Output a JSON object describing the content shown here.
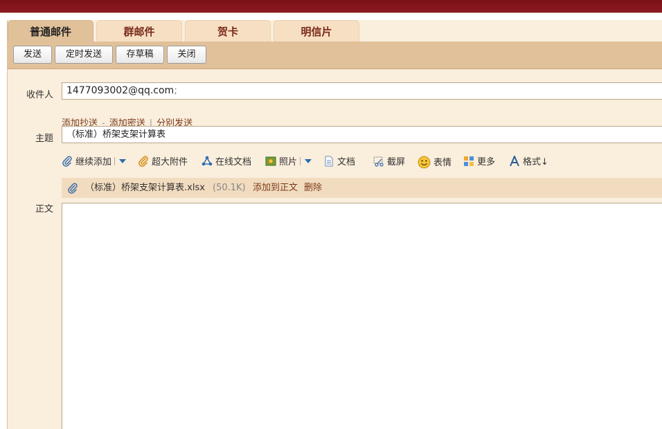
{
  "tabs": [
    {
      "label": "普通邮件",
      "active": true
    },
    {
      "label": "群邮件",
      "active": false
    },
    {
      "label": "贺卡",
      "active": false
    },
    {
      "label": "明信片",
      "active": false
    }
  ],
  "toolbar": {
    "send": "发送",
    "schedule_send": "定时发送",
    "save_draft": "存草稿",
    "close": "关闭"
  },
  "form": {
    "to_label": "收件人",
    "to_value": "1477093002@qq.com",
    "to_separator": ";",
    "add_cc": "添加抄送",
    "dash": "-",
    "add_bcc": "添加密送",
    "pipe": "|",
    "separate_send": "分别发送",
    "subject_label": "主题",
    "subject_value": "（标准）桥架支架计算表",
    "body_label": "正文"
  },
  "attach_bar": {
    "continue_add": "继续添加",
    "large_attach": "超大附件",
    "online_doc": "在线文档",
    "photo": "照片",
    "document": "文档",
    "screenshot": "截屏",
    "emoji": "表情",
    "more": "更多",
    "format": "格式↓"
  },
  "attachment": {
    "filename": "（标准）桥架支架计算表.xlsx",
    "size": "(50.1K)",
    "add_to_body": "添加到正文",
    "delete": "删除"
  },
  "colors": {
    "header_band": "#7a1018",
    "toolbar": "#e1c19a",
    "panel": "#faeedd",
    "link": "#7a3a1a"
  }
}
